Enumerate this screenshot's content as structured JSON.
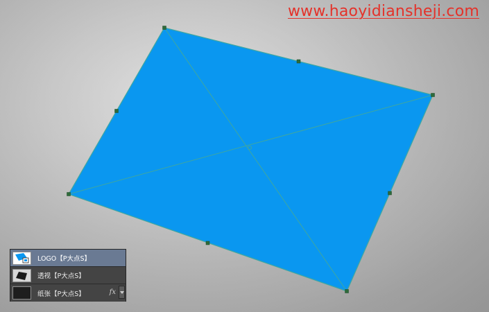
{
  "watermark": {
    "text": "www.haoyidiansheji.com",
    "color": "#e4322a"
  },
  "canvas": {
    "shape_fill": "#0a97f0",
    "transform_line_color": "#3fa7a0",
    "handle_color": "#2e6b3a",
    "background": "#c9c9c9"
  },
  "layers_panel": {
    "layers": [
      {
        "name": "LOGO【P大点S】",
        "thumbnail": "logo-thumbnail-icon",
        "selected": true,
        "has_fx": false
      },
      {
        "name": "透视【P大点S】",
        "thumbnail": "perspective-thumbnail-icon",
        "selected": false,
        "has_fx": false
      },
      {
        "name": "纸张【P大点S】",
        "thumbnail": "paper-thumbnail-icon",
        "selected": false,
        "has_fx": true,
        "fx_label": "fx"
      }
    ]
  }
}
